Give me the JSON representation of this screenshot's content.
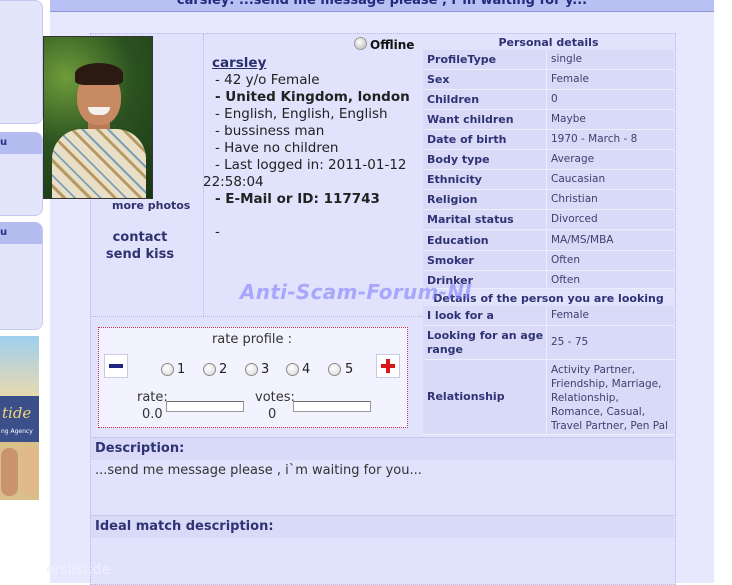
{
  "page": {
    "title": "carsley: ...send me message please , i`m waiting for y...",
    "watermark": "Anti-Scam-Forum-NI",
    "source_watermark": "erslist.de"
  },
  "sidebar": {
    "tabs": [
      "u",
      "u"
    ],
    "ad": {
      "text": "tide",
      "subtext": "ng Agency"
    }
  },
  "profile": {
    "status": "Offline",
    "name": "carsley",
    "lines": [
      "- 42 y/o Female",
      "- United Kingdom, london",
      "- English, English, English",
      "- bussiness man",
      "- Have no children",
      "- Last logged in: 2011-01-12",
      "22:58:04",
      "- E-Mail or ID: 117743",
      "-"
    ],
    "more_photos": "more photos",
    "contact": "contact",
    "send_kiss": "send kiss"
  },
  "rating": {
    "title": "rate profile :",
    "options": [
      "1",
      "2",
      "3",
      "4",
      "5"
    ],
    "rate_label": "rate:",
    "rate_value": "0.0",
    "votes_label": "votes:",
    "votes_value": "0"
  },
  "personal_details": {
    "heading": "Personal details",
    "rows": [
      {
        "key": "ProfileType",
        "value": "single"
      },
      {
        "key": "Sex",
        "value": "Female"
      },
      {
        "key": "Children",
        "value": "0"
      },
      {
        "key": "Want children",
        "value": "Maybe"
      },
      {
        "key": "Date of birth",
        "value": "1970 - March - 8"
      },
      {
        "key": "Body type",
        "value": "Average"
      },
      {
        "key": "Ethnicity",
        "value": "Caucasian"
      },
      {
        "key": "Religion",
        "value": "Christian"
      },
      {
        "key": "Marital status",
        "value": "Divorced"
      },
      {
        "key": "Education",
        "value": "MA/MS/MBA"
      },
      {
        "key": "Smoker",
        "value": "Often"
      },
      {
        "key": "Drinker",
        "value": "Often"
      }
    ]
  },
  "looking_for": {
    "heading": "Details of the person you are looking for",
    "rows": [
      {
        "key": "I look for a",
        "value": "Female"
      },
      {
        "key": "Looking for an age range",
        "value": "25 -  75"
      },
      {
        "key": "Relationship",
        "value": "Activity Partner, Friendship, Marriage, Relationship, Romance, Casual, Travel Partner, Pen Pal"
      }
    ]
  },
  "description": {
    "heading": "Description:",
    "text": "...send me message please , i`m waiting for you...",
    "ideal_heading": "Ideal match description:"
  }
}
